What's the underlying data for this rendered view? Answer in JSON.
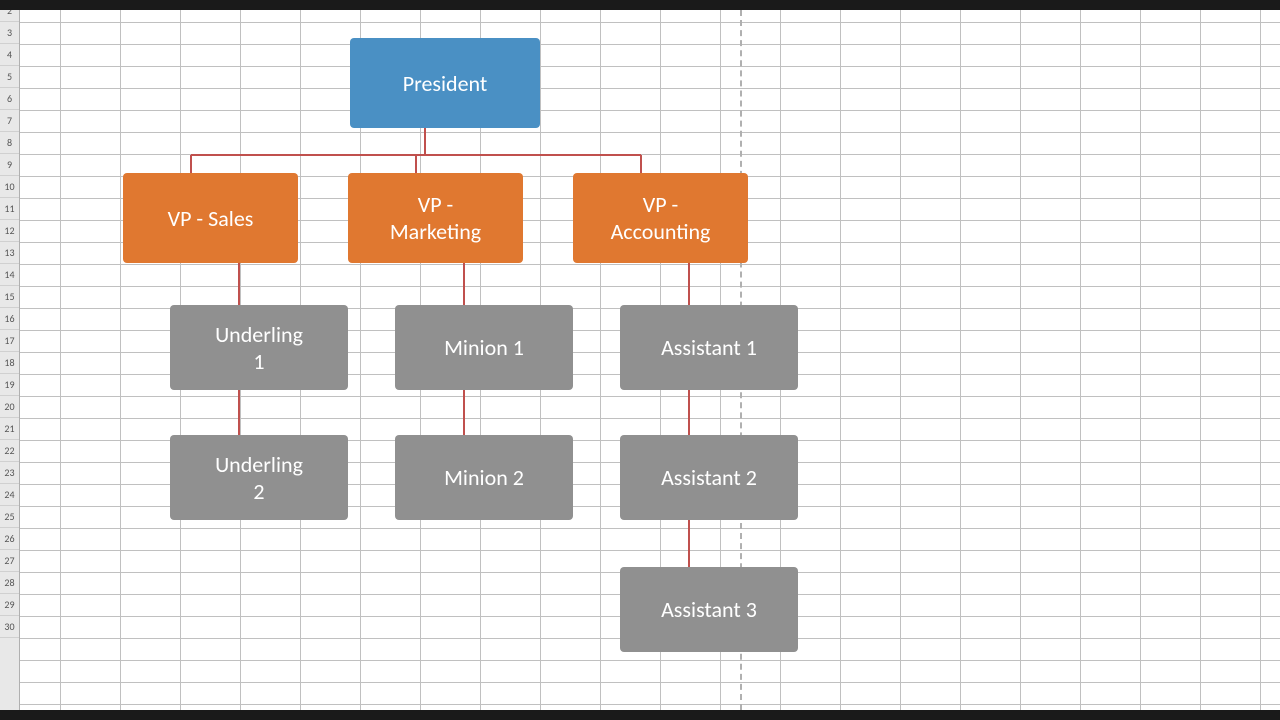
{
  "topBar": {},
  "bottomBar": {},
  "rowNumbers": [
    2,
    3,
    4,
    5,
    6,
    7,
    8,
    9,
    10,
    11,
    12,
    13,
    14,
    15,
    16,
    17,
    18,
    19,
    20,
    21,
    22,
    23,
    24,
    25,
    26,
    27,
    28,
    29,
    30
  ],
  "nodes": {
    "president": "President",
    "vpSales": "VP - Sales",
    "vpMarketing": "VP - \nMarketing",
    "vpAccounting": "VP - \nAccounting",
    "underling1": "Underling 1",
    "underling2": "Underling 2",
    "minion1": "Minion 1",
    "minion2": "Minion 2",
    "assistant1": "Assistant 1",
    "assistant2": "Assistant 2",
    "assistant3": "Assistant 3"
  },
  "colors": {
    "president": "#4a90c4",
    "vp": "#e07830",
    "subordinate": "#909090",
    "connector": "#c0504d"
  }
}
